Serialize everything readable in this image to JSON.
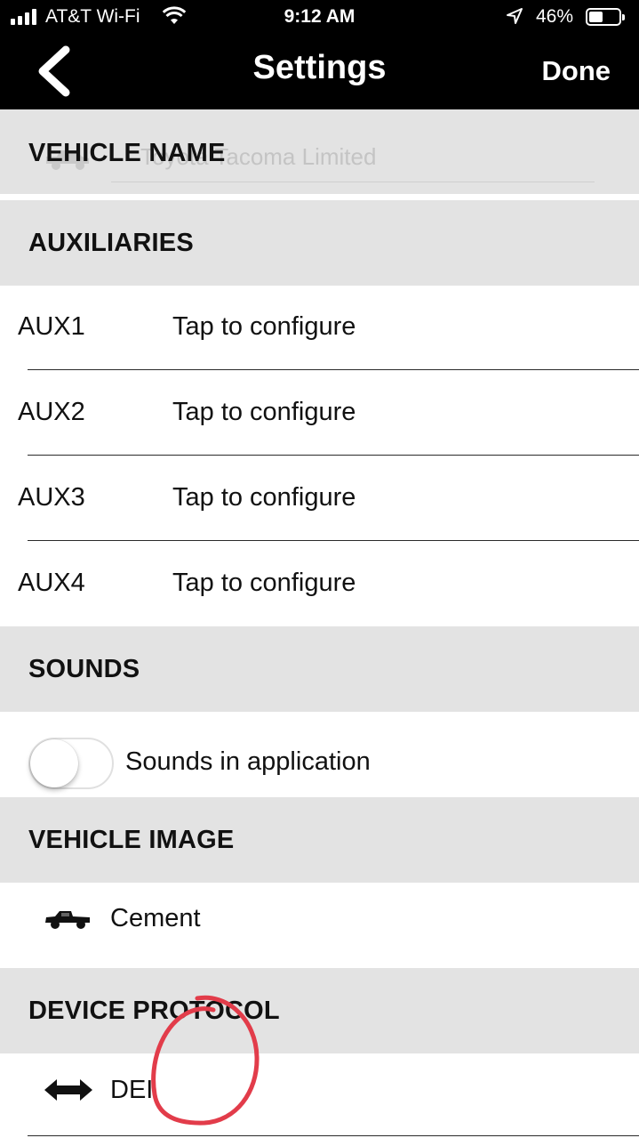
{
  "status_bar": {
    "carrier": "AT&T Wi-Fi",
    "time": "9:12 AM",
    "battery_percent": "46%",
    "battery_level": 0.46,
    "signal_bars": 4,
    "icons": [
      "wifi-icon",
      "location-arrow-icon",
      "battery-icon"
    ]
  },
  "nav": {
    "title": "Settings",
    "done_label": "Done",
    "back_icon": "chevron-left-icon"
  },
  "vehicle_name": {
    "header": "VEHICLE NAME",
    "value": "Toyota Tacoma Limited",
    "icon": "car-icon"
  },
  "auxiliaries": {
    "header": "AUXILIARIES",
    "items": [
      {
        "label": "AUX1",
        "value": "Tap to configure"
      },
      {
        "label": "AUX2",
        "value": "Tap to configure"
      },
      {
        "label": "AUX3",
        "value": "Tap to configure"
      },
      {
        "label": "AUX4",
        "value": "Tap to configure"
      }
    ]
  },
  "sounds": {
    "header": "SOUNDS",
    "toggle_label": "Sounds in application",
    "enabled": false
  },
  "vehicle_image": {
    "header": "VEHICLE IMAGE",
    "value": "Cement",
    "icon": "truck-icon"
  },
  "device_protocol": {
    "header": "DEVICE PROTOCOL",
    "value": "DEI",
    "icon": "double-arrow-icon"
  },
  "annotation": {
    "color": "#e23c4a",
    "shape": "hand-drawn-circle"
  }
}
